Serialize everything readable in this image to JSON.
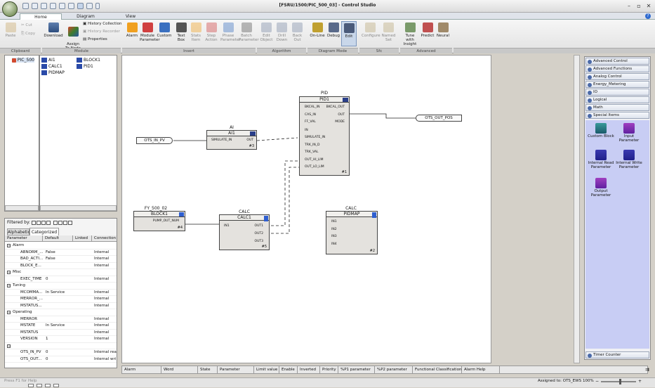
{
  "window": {
    "title": "[FSRU/1500/PIC_500_03] - Control Studio"
  },
  "tabs": [
    "Home",
    "Diagram",
    "View"
  ],
  "ribbon": {
    "clipboard": {
      "paste": "Paste",
      "cut": "Cut",
      "copy": "Copy",
      "group": "Clipboard"
    },
    "module": {
      "download": "Download",
      "assign": "Assign\nTo Node",
      "history_collection": "History Collection",
      "history_recorder": "History Recorder",
      "properties": "Properties",
      "group": "Module"
    },
    "insert": {
      "items": [
        "Alarm",
        "Module\nParameter",
        "Custom",
        "Text\nBox",
        "Stats\nItem",
        "Step\nAction",
        "Phase\nParameter",
        "Batch\nParameter"
      ],
      "group": "Insert"
    },
    "algorithm": {
      "items": [
        "Edit\nObject",
        "Drill\nDown",
        "Back\nOut"
      ],
      "group": "Algorithm"
    },
    "diagram_mode": {
      "items": [
        "On-Line",
        "Debug",
        "Edit"
      ],
      "group": "Diagram Mode"
    },
    "sfc": {
      "items": [
        "Configure",
        "Named\nSet"
      ],
      "group": "Sfc"
    },
    "advanced": {
      "items": [
        "Tune with\nInsight",
        "Predict",
        "Neural"
      ],
      "group": "Advanced"
    }
  },
  "tree": {
    "root": "PIC_500"
  },
  "blocks_list": [
    {
      "name": "AI1",
      "icon": "ai-block-icon"
    },
    {
      "name": "BLOCK1",
      "icon": "block-icon"
    },
    {
      "name": "CALC1",
      "icon": "calc-block-icon"
    },
    {
      "name": "PID1",
      "icon": "pid-block-icon"
    },
    {
      "name": "PIDMAP",
      "icon": "calc-block-icon"
    }
  ],
  "params": {
    "filtered_by": "Filtered by:",
    "tabs": [
      "Alphabetic",
      "Categorized"
    ],
    "headers": [
      "Parameter",
      "Default",
      "Linked",
      "Connection"
    ],
    "rows": [
      {
        "type": "cat",
        "name": "Alarm"
      },
      {
        "type": "row",
        "name": "ABNORM_...",
        "default": "False",
        "conn": "Internal"
      },
      {
        "type": "row",
        "name": "BAD_ACTI...",
        "default": "False",
        "conn": "Internal"
      },
      {
        "type": "row",
        "name": "BLOCK_E...",
        "default": "",
        "conn": "Internal"
      },
      {
        "type": "cat",
        "name": "Misc"
      },
      {
        "type": "row",
        "name": "EXEC_TIME",
        "default": "0",
        "conn": "Internal"
      },
      {
        "type": "cat",
        "name": "Tuning"
      },
      {
        "type": "row",
        "name": "MCOMMA...",
        "default": "In Service",
        "conn": "Internal"
      },
      {
        "type": "row",
        "name": "MERROR_...",
        "default": "",
        "conn": "Internal"
      },
      {
        "type": "row",
        "name": "MSTATUS...",
        "default": "",
        "conn": "Internal"
      },
      {
        "type": "cat",
        "name": "Operating"
      },
      {
        "type": "row",
        "name": "MERROR",
        "default": "",
        "conn": "Internal"
      },
      {
        "type": "row",
        "name": "MSTATE",
        "default": "In Service",
        "conn": "Internal"
      },
      {
        "type": "row",
        "name": "MSTATUS",
        "default": "",
        "conn": "Internal"
      },
      {
        "type": "row",
        "name": "VERSION",
        "default": "1",
        "conn": "Internal"
      },
      {
        "type": "cat",
        "name": ""
      },
      {
        "type": "row",
        "name": "OTS_IN_PV",
        "default": "0",
        "conn": "Internal rea"
      },
      {
        "type": "row",
        "name": "OTS_OUT...",
        "default": "0",
        "conn": "Internal wri"
      }
    ]
  },
  "diagram": {
    "in_term": "OTS_IN_PV",
    "out_term": "OTS_OUT_POS",
    "ai": {
      "type": "AI",
      "name": "AI1",
      "pins_in": [
        "SIMULATE_IN"
      ],
      "pins_out": [
        "OUT"
      ],
      "num": "#3"
    },
    "pid": {
      "type": "PID",
      "name": "PID1",
      "pins_in": [
        "BKCAL_IN",
        "CAS_IN",
        "FF_VAL",
        "IN",
        "SIMULATE_IN",
        "TRK_IN_D",
        "TRK_VAL",
        "OUT_HI_LIM",
        "OUT_LO_LIM"
      ],
      "pins_out": [
        "BKCAL_OUT",
        "OUT",
        "MODE"
      ],
      "num": "#1"
    },
    "fy": {
      "type": "FY_500_02",
      "name": "BLOCK1",
      "pins_out": [
        "PUMP_OUT_NUM"
      ],
      "num": "#4"
    },
    "calc1": {
      "type": "CALC",
      "name": "CALC1",
      "pins_in": [
        "IN1"
      ],
      "pins_out": [
        "OUT1",
        "OUT2",
        "OUT3"
      ],
      "num": "#5"
    },
    "pidmap": {
      "type": "CALC",
      "name": "PIDMAP",
      "pins_in": [
        "IN1",
        "IN2",
        "IN3",
        "IN4"
      ],
      "num": "#2"
    }
  },
  "palette": {
    "categories": [
      "Advanced Control",
      "Advanced Functions",
      "Analog Control",
      "Energy_Metering",
      "IO",
      "Logical",
      "Math",
      "Special Items"
    ],
    "tools": [
      "Custom Block",
      "Input\nParameter",
      "Internal Read\nParameter",
      "Internal Write\nParameter",
      "Output\nParameter"
    ],
    "timer": "Timer Counter"
  },
  "alarm_headers": [
    "Alarm",
    "Word",
    "State",
    "Parameter",
    "Limit value",
    "Enable",
    "Inverted",
    "Priority",
    "%P1 parameter",
    "%P2 parameter",
    "Functional Classification",
    "Alarm Help"
  ],
  "status": {
    "hint": "Press F1 for Help",
    "assigned": "Assigned to: OTS_EWS",
    "zoom": "100%"
  }
}
